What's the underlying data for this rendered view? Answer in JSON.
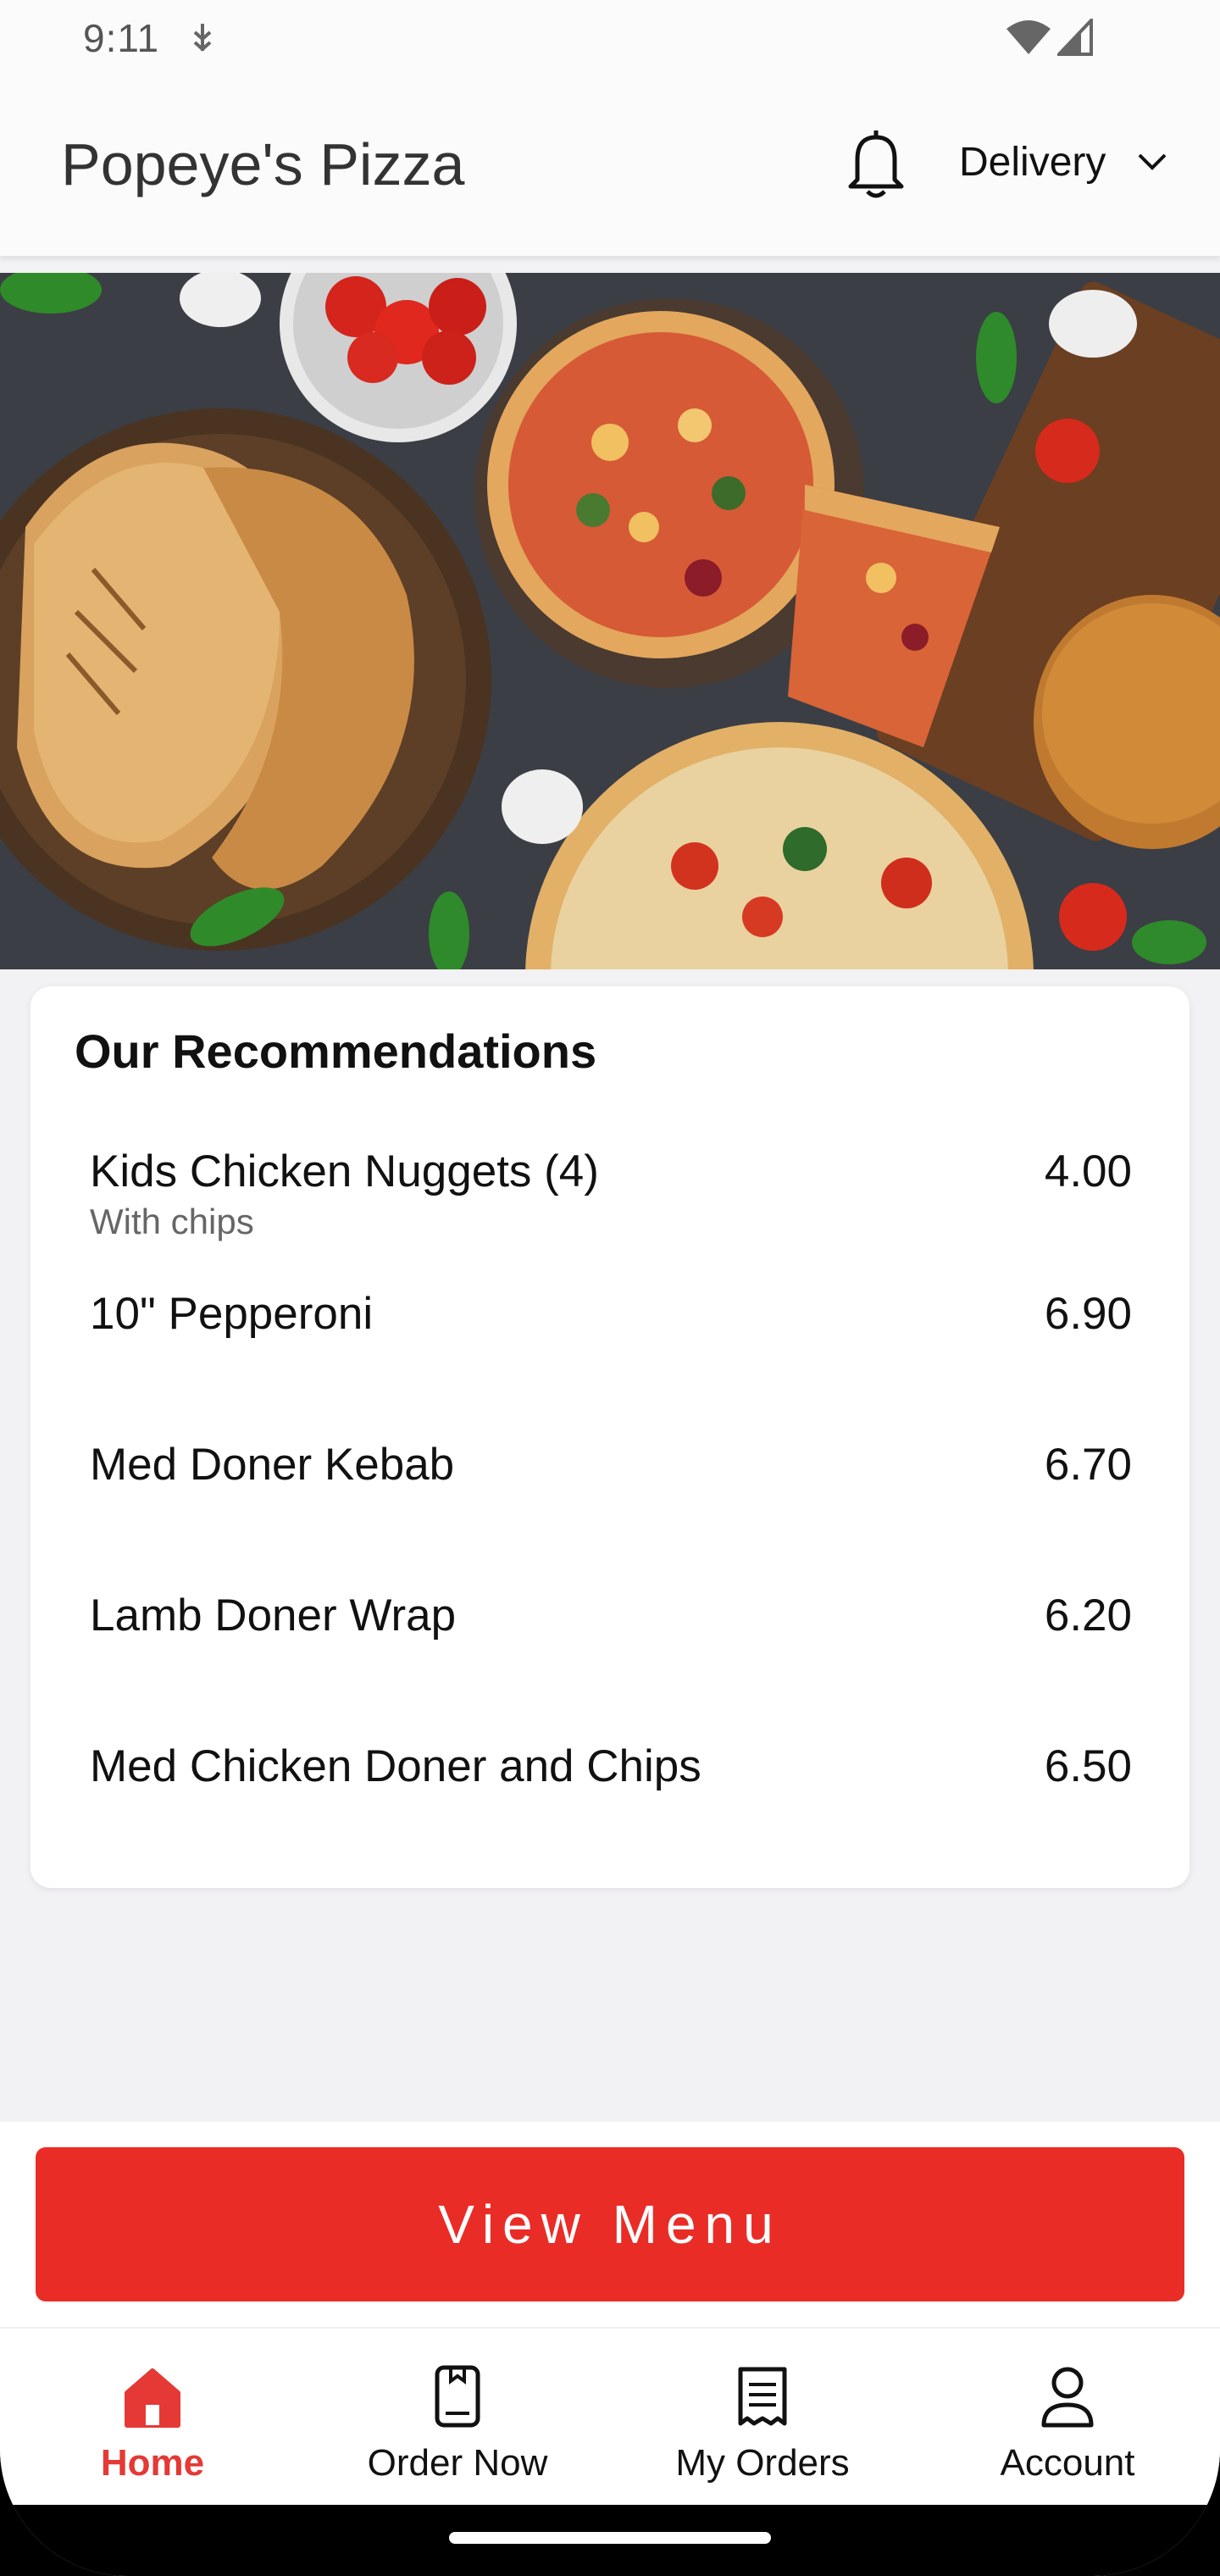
{
  "status_bar": {
    "time": "9:11"
  },
  "header": {
    "title": "Popeye's Pizza",
    "mode": "Delivery"
  },
  "hero": {
    "image": "food-banner"
  },
  "recommendations": {
    "title": "Our Recommendations",
    "items": [
      {
        "name": "Kids Chicken Nuggets (4)",
        "desc": "With chips",
        "price": "4.00"
      },
      {
        "name": "10\" Pepperoni",
        "desc": "",
        "price": "6.90"
      },
      {
        "name": "Med Doner Kebab",
        "desc": "",
        "price": "6.70"
      },
      {
        "name": "Lamb Doner Wrap",
        "desc": "",
        "price": "6.20"
      },
      {
        "name": "Med Chicken Doner and Chips",
        "desc": "",
        "price": "6.50"
      }
    ]
  },
  "cta": {
    "label": "View Menu"
  },
  "nav": {
    "items": [
      {
        "label": "Home",
        "icon": "home-icon",
        "active": true
      },
      {
        "label": "Order Now",
        "icon": "order-icon",
        "active": false
      },
      {
        "label": "My Orders",
        "icon": "receipt-icon",
        "active": false
      },
      {
        "label": "Account",
        "icon": "person-icon",
        "active": false
      }
    ]
  },
  "colors": {
    "accent": "#ea2c27",
    "active_nav": "#e53935"
  }
}
